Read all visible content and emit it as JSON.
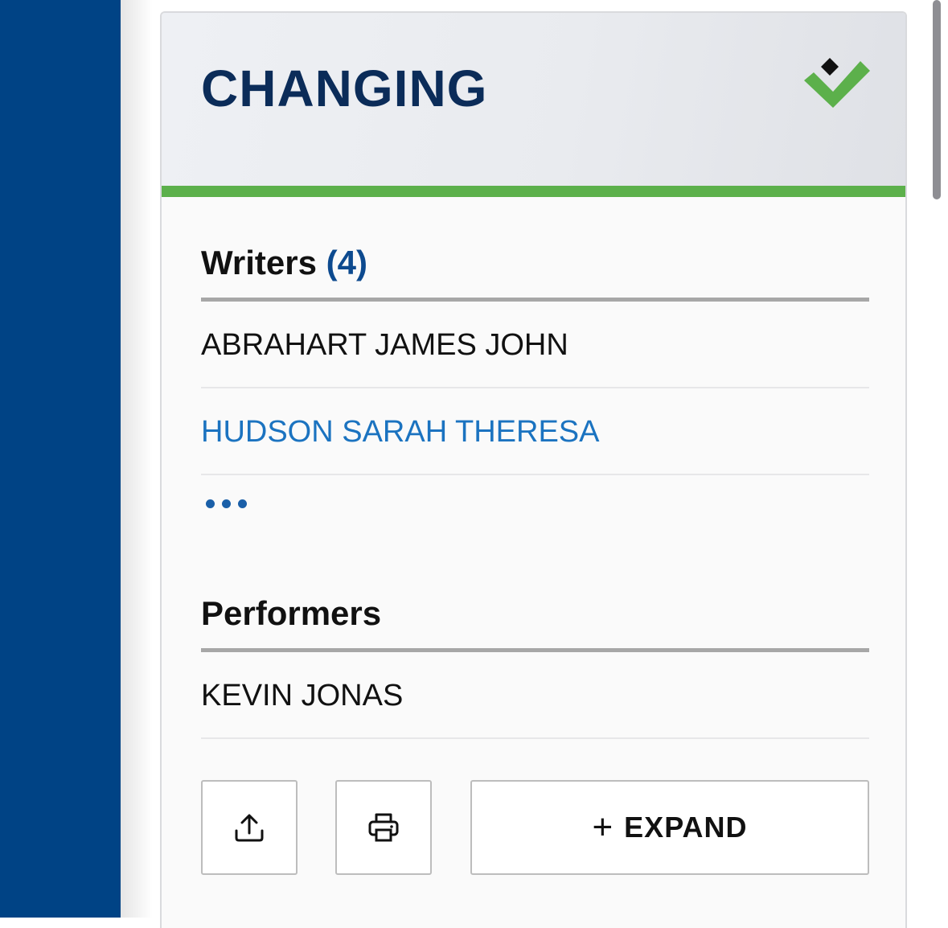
{
  "card": {
    "title": "CHANGING",
    "status_icon": "check-icon",
    "accent_color": "#5cb04b"
  },
  "writers": {
    "heading": "Writers",
    "count": "(4)",
    "items": [
      {
        "name": "ABRAHART JAMES JOHN",
        "link": false
      },
      {
        "name": "HUDSON SARAH THERESA",
        "link": true
      }
    ],
    "more_icon": "ellipsis-icon"
  },
  "performers": {
    "heading": "Performers",
    "items": [
      {
        "name": "KEVIN JONAS"
      }
    ]
  },
  "actions": {
    "share_icon": "share-icon",
    "print_icon": "print-icon",
    "expand_label": "EXPAND",
    "expand_icon": "+"
  },
  "colors": {
    "sidebar": "#004385",
    "title": "#0b2c59",
    "count": "#0d4a8f",
    "link": "#1b73c0"
  }
}
